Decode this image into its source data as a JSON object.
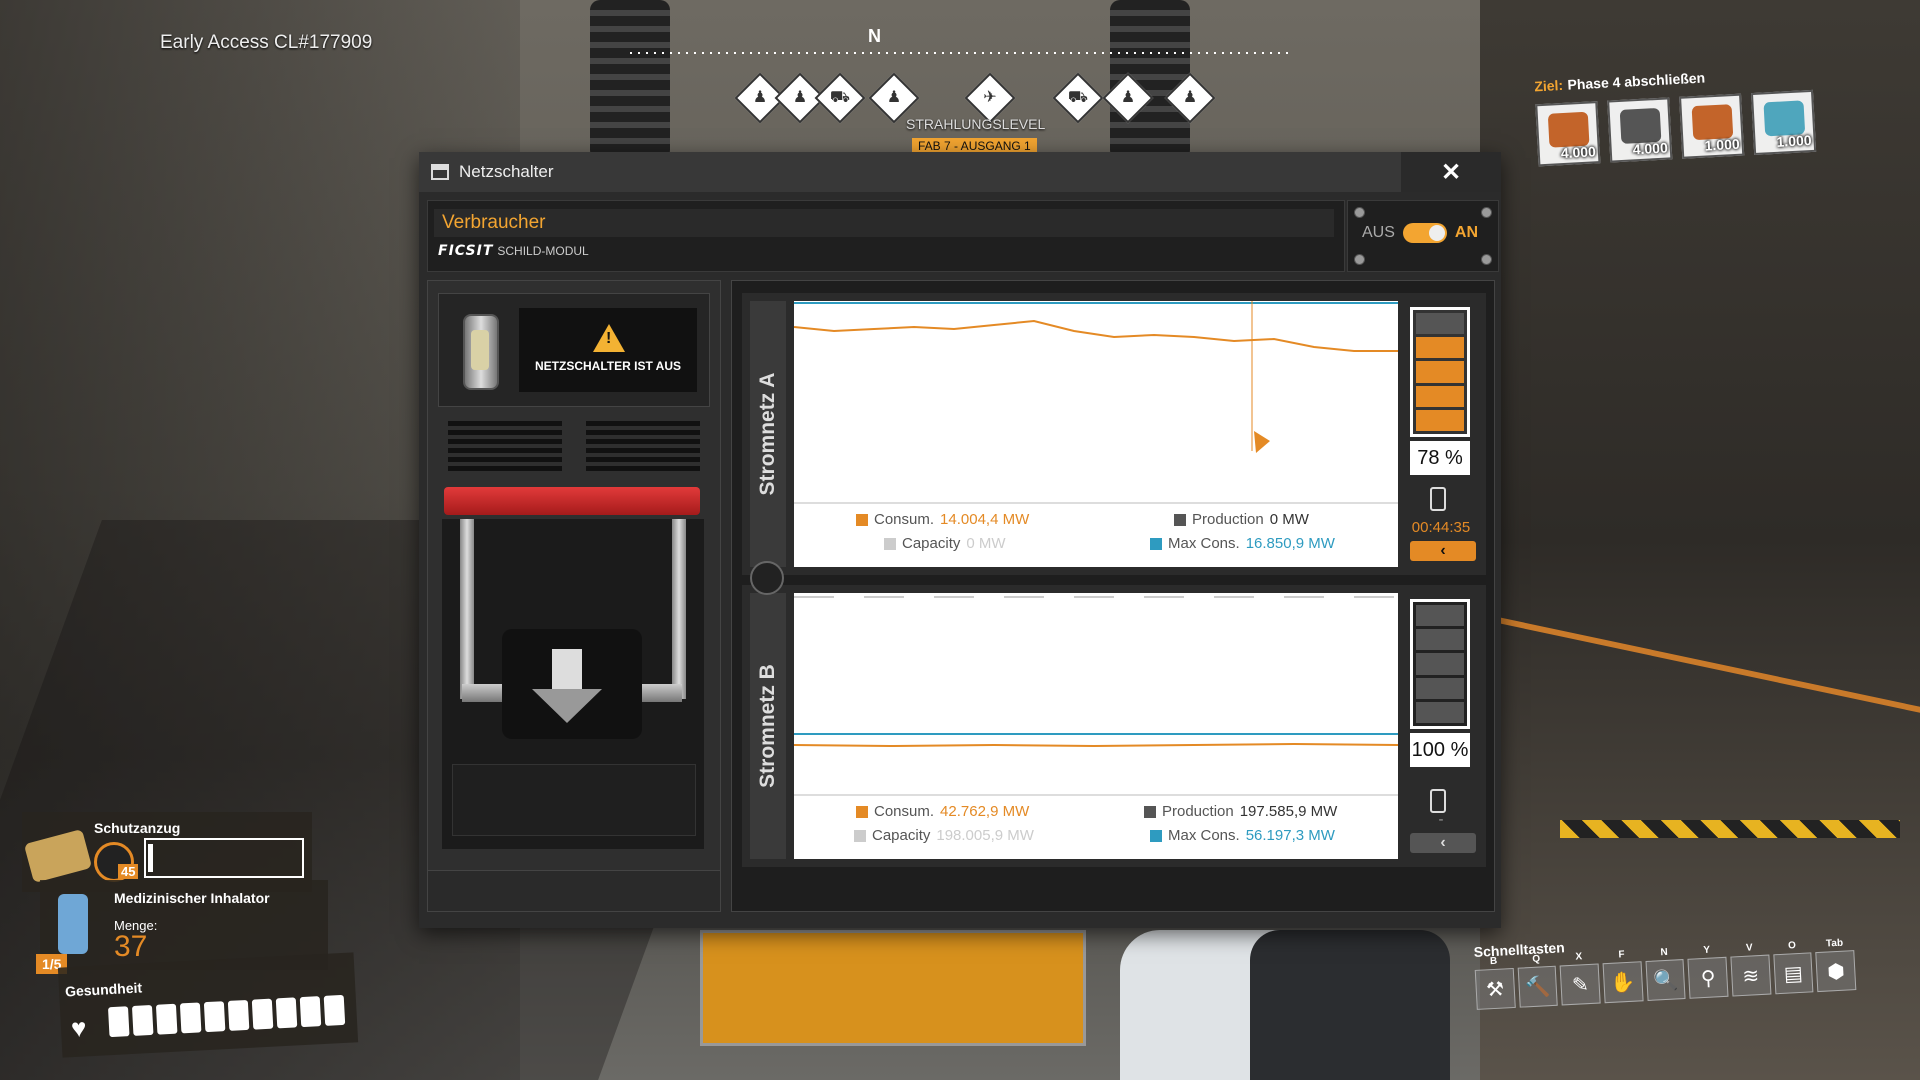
{
  "hud": {
    "build": "Early Access CL#177909",
    "compass_north": "N",
    "radiation_label": "STRAHLUNGSLEVEL",
    "radiation_sub": "FAB 7 - AUSGANG 1",
    "goal_label": "Ziel:",
    "goal_title": "Phase 4 abschließen",
    "goal_items": [
      {
        "count": "4.000",
        "icon": "motor-icon"
      },
      {
        "count": "4.000",
        "icon": "rotor-icon"
      },
      {
        "count": "1.000",
        "icon": "module-icon"
      },
      {
        "count": "1.000",
        "icon": "computer-icon"
      }
    ]
  },
  "window": {
    "title": "Netzschalter",
    "close_label": "✕",
    "name_value": "Verbraucher",
    "brand": "FICSIT",
    "module": "SCHILD-MODUL",
    "toggle_off": "AUS",
    "toggle_on": "AN",
    "switch_status": "NETZSCHALTER IST AUS"
  },
  "grid_a": {
    "label": "Stromnetz A",
    "consum_label": "Consum.",
    "consum_value": "14.004,4 MW",
    "production_label": "Production",
    "production_value": "0 MW",
    "capacity_label": "Capacity",
    "capacity_value": "0 MW",
    "maxcons_label": "Max Cons.",
    "maxcons_value": "16.850,9 MW",
    "battery_percent": "78 %",
    "battery_level": 0.78,
    "battery_time": "00:44:35",
    "btn": "‹"
  },
  "grid_b": {
    "label": "Stromnetz B",
    "consum_label": "Consum.",
    "consum_value": "42.762,9 MW",
    "production_label": "Production",
    "production_value": "197.585,9 MW",
    "capacity_label": "Capacity",
    "capacity_value": "198.005,9 MW",
    "maxcons_label": "Max Cons.",
    "maxcons_value": "56.197,3 MW",
    "battery_percent": "100 %",
    "battery_level": 1.0,
    "battery_time": "-",
    "btn": "‹"
  },
  "bottom": {
    "suit_label": "Schutzanzug",
    "suit_level": "45",
    "inhaler_title": "Medizinischer Inhalator",
    "inhaler_qty_label": "Menge:",
    "inhaler_qty": "37",
    "inhaler_slot": "1/5",
    "health_label": "Gesundheit",
    "hotkeys_title": "Schnelltasten",
    "hotkeys": [
      {
        "key": "B",
        "icon": "build-icon"
      },
      {
        "key": "Q",
        "icon": "hammer-icon"
      },
      {
        "key": "X",
        "icon": "dismantle-icon"
      },
      {
        "key": "F",
        "icon": "hand-icon"
      },
      {
        "key": "N",
        "icon": "scan-icon"
      },
      {
        "key": "Y",
        "icon": "map-pin-icon"
      },
      {
        "key": "V",
        "icon": "signal-icon"
      },
      {
        "key": "O",
        "icon": "inventory-icon"
      },
      {
        "key": "Tab",
        "icon": "cube-icon"
      }
    ]
  },
  "colors": {
    "accent": "#e48a25",
    "blue": "#2e9bc0"
  }
}
